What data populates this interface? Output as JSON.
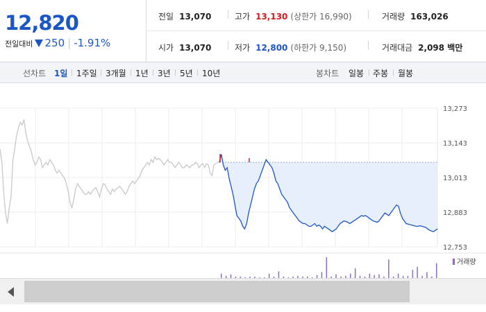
{
  "quote": {
    "price": "12,820",
    "change_label": "전일대비",
    "change": "250",
    "change_pct": "-1.91%"
  },
  "stats": {
    "prev_close": {
      "label": "전일",
      "value": "13,070"
    },
    "high": {
      "label": "고가",
      "value": "13,130",
      "sub": "(상한가 16,990)"
    },
    "volume": {
      "label": "거래량",
      "value": "163,026"
    },
    "open": {
      "label": "시가",
      "value": "13,070"
    },
    "low": {
      "label": "저가",
      "value": "12,800",
      "sub": "(하한가 9,150)"
    },
    "trade_value": {
      "label": "거래대금",
      "value": "2,098 백만"
    }
  },
  "tabs": {
    "line_label": "선차트",
    "line_periods": [
      "1일",
      "1주일",
      "3개월",
      "1년",
      "3년",
      "5년",
      "10년"
    ],
    "active_period": "1일",
    "candle_label": "봉차트",
    "candle_periods": [
      "일봉",
      "주봉",
      "월봉"
    ]
  },
  "colors": {
    "down": "#1b56c9",
    "up": "#d61a1a",
    "prev_day_line": "#c8c8c8",
    "fill": "#e6effb",
    "volume": "#8a6fb8"
  },
  "chart_data": {
    "type": "line",
    "y_ticks": [
      "13,273",
      "13,143",
      "13,013",
      "12,883",
      "12,753"
    ],
    "ylim": [
      12753,
      13273
    ],
    "reference_level": 13070,
    "grid": true,
    "legend": {
      "volume": "거래량"
    },
    "series": [
      {
        "values": [
          13120,
          13070,
          12960,
          12880,
          12840,
          12900,
          12940,
          13080,
          13120,
          13170,
          13200,
          13220,
          13210,
          13230,
          13180,
          13150,
          13130,
          13110,
          13080,
          13060,
          13070,
          13090,
          13080,
          13050,
          13060,
          13070,
          13060,
          13080,
          13070,
          13060,
          13040,
          13030,
          13040,
          13030,
          13020,
          13010,
          12990,
          12960,
          12920,
          12900,
          12930,
          12970,
          12990,
          12980,
          12970,
          12960,
          12950,
          12950,
          12960,
          12950,
          12960,
          12970,
          12975,
          12960,
          12940,
          12970,
          12990,
          12985,
          12970,
          12960,
          12950,
          12970,
          12960,
          12970,
          12975,
          12980,
          12970,
          12960,
          12950,
          12960,
          12980,
          12990,
          13000,
          12990,
          13000,
          13010,
          13020,
          13040,
          13050,
          13060,
          13070,
          13060,
          13080,
          13070,
          13090,
          13080,
          13085,
          13080,
          13070,
          13060,
          13070,
          13080,
          13070,
          13070,
          13060,
          13050,
          13060,
          13070,
          13060,
          13050,
          13050,
          13060,
          13055,
          13050,
          13060,
          13060,
          13070,
          13065,
          13050,
          13060,
          13065,
          13050,
          13065,
          13060,
          13030,
          13020,
          13060,
          13065,
          13070,
          13070
        ]
      },
      {
        "values": [
          13070,
          13100,
          13060,
          13040,
          13050,
          13010,
          12980,
          12950,
          12910,
          12870,
          12860,
          12850,
          12830,
          12820,
          12840,
          12880,
          12910,
          12940,
          12970,
          12990,
          13000,
          13020,
          13040,
          13060,
          13080,
          13070,
          13060,
          13050,
          13030,
          13000,
          12990,
          12970,
          12950,
          12940,
          12930,
          12920,
          12900,
          12890,
          12880,
          12870,
          12860,
          12850,
          12845,
          12840,
          12840,
          12835,
          12830,
          12830,
          12835,
          12840,
          12830,
          12835,
          12830,
          12820,
          12830,
          12825,
          12820,
          12815,
          12810,
          12815,
          12820,
          12830,
          12840,
          12845,
          12850,
          12848,
          12845,
          12840,
          12845,
          12850,
          12855,
          12860,
          12865,
          12870,
          12868,
          12870,
          12866,
          12860,
          12855,
          12850,
          12848,
          12845,
          12850,
          12860,
          12870,
          12880,
          12875,
          12870,
          12880,
          12890,
          12900,
          12910,
          12905,
          12880,
          12860,
          12850,
          12840,
          12838,
          12836,
          12834,
          12832,
          12830,
          12830,
          12832,
          12830,
          12828,
          12826,
          12820,
          12815,
          12812,
          12810,
          12815,
          12820
        ]
      }
    ],
    "volume_values": [
      6,
      3,
      5,
      2,
      2,
      1,
      2,
      2,
      1,
      1,
      6,
      2,
      9,
      2,
      1,
      2,
      3,
      2,
      2,
      1,
      4,
      8,
      28,
      2,
      5,
      2,
      3,
      6,
      13,
      3,
      2,
      6,
      4,
      5,
      2,
      25,
      2,
      6,
      3,
      3,
      11,
      15,
      3,
      8,
      2,
      20
    ]
  }
}
